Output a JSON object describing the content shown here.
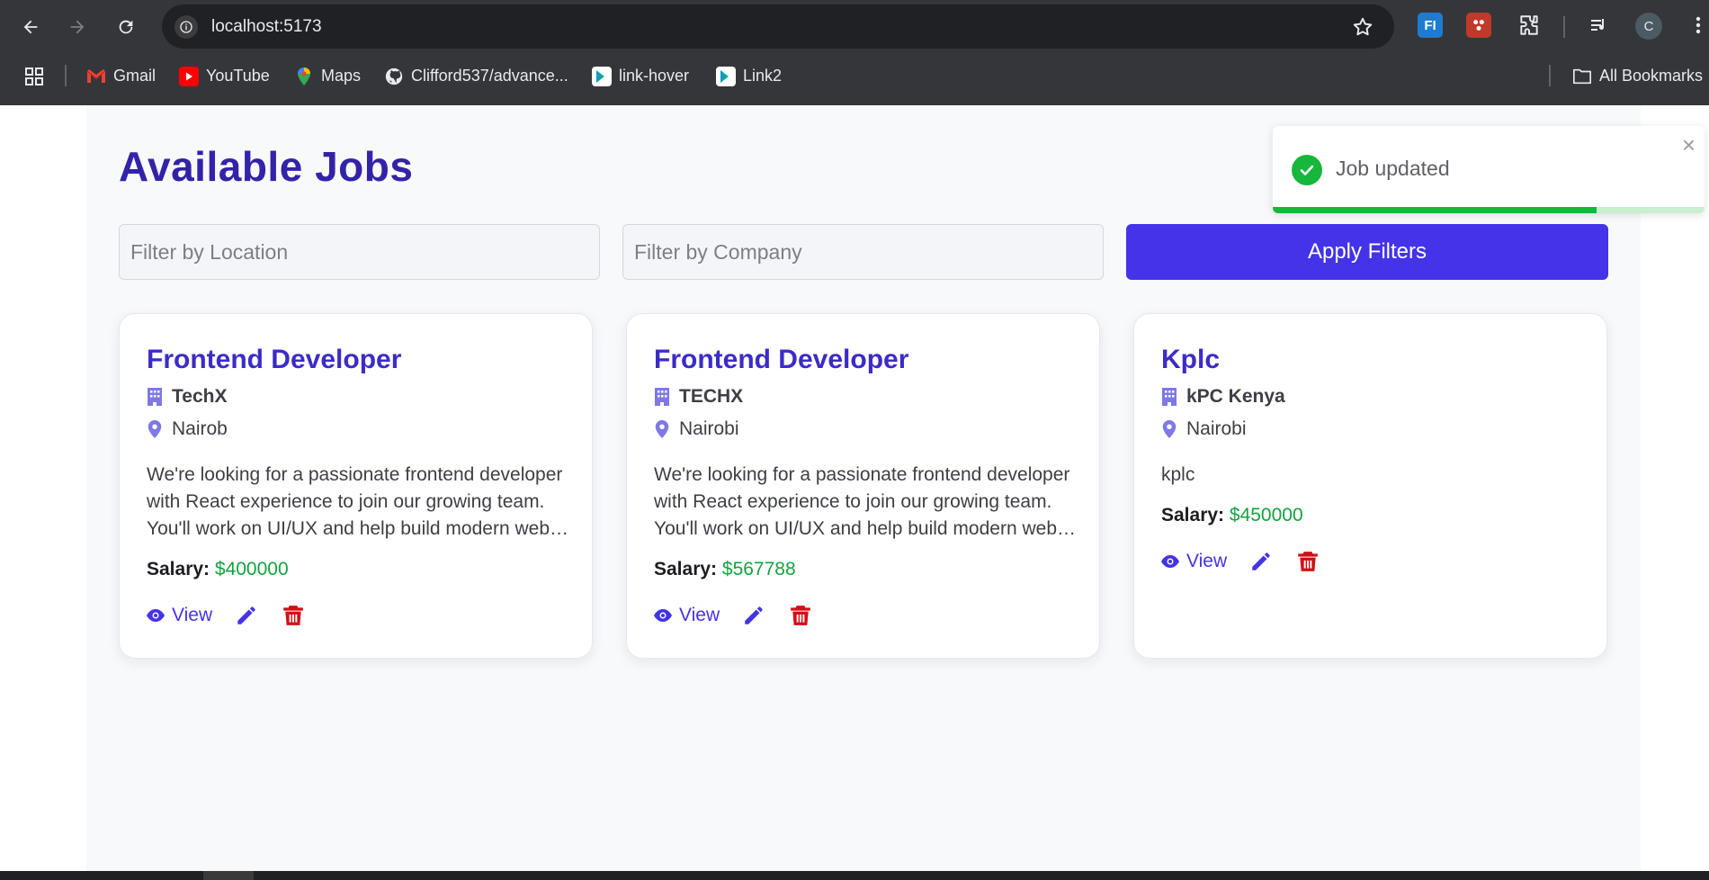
{
  "browser": {
    "url": "localhost:5173",
    "profile_initial": "C",
    "extensions": [
      {
        "name": "fi-extension-icon",
        "label": "FI"
      },
      {
        "name": "red-extension-icon",
        "label": ""
      }
    ],
    "bookmarks": [
      {
        "label": "Gmail",
        "icon": "gmail-icon"
      },
      {
        "label": "YouTube",
        "icon": "youtube-icon"
      },
      {
        "label": "Maps",
        "icon": "maps-icon"
      },
      {
        "label": "Clifford537/advance...",
        "icon": "github-icon"
      },
      {
        "label": "link-hover",
        "icon": "play-store-icon"
      },
      {
        "label": "Link2",
        "icon": "play-store-icon"
      }
    ],
    "all_bookmarks_label": "All Bookmarks"
  },
  "page": {
    "title": "Available Jobs",
    "filters": {
      "location_placeholder": "Filter by Location",
      "company_placeholder": "Filter by Company",
      "apply_label": "Apply Filters"
    },
    "salary_label": "Salary:",
    "view_label": "View",
    "jobs": [
      {
        "title": "Frontend Developer",
        "company": "TechX",
        "location": "Nairob",
        "description": "We're looking for a passionate frontend developer with React experience to join our growing team. You'll work on UI/UX and help build modern web applications.",
        "salary": "$400000"
      },
      {
        "title": "Frontend Developer",
        "company": "TECHX",
        "location": "Nairobi",
        "description": "We're looking for a passionate frontend developer with React experience to join our growing team. You'll work on UI/UX and help build modern web applications.",
        "salary": "$567788"
      },
      {
        "title": "Kplc",
        "company": "kPC Kenya",
        "location": "Nairobi",
        "description": "kplc",
        "salary": "$450000"
      }
    ]
  },
  "toast": {
    "message": "Job updated",
    "close_symbol": "×",
    "progress_fraction": 0.75
  },
  "colors": {
    "accent": "#4433e8",
    "title": "#3323a8",
    "salary": "#12a33f",
    "delete": "#d20f16",
    "success": "#16b73a"
  }
}
